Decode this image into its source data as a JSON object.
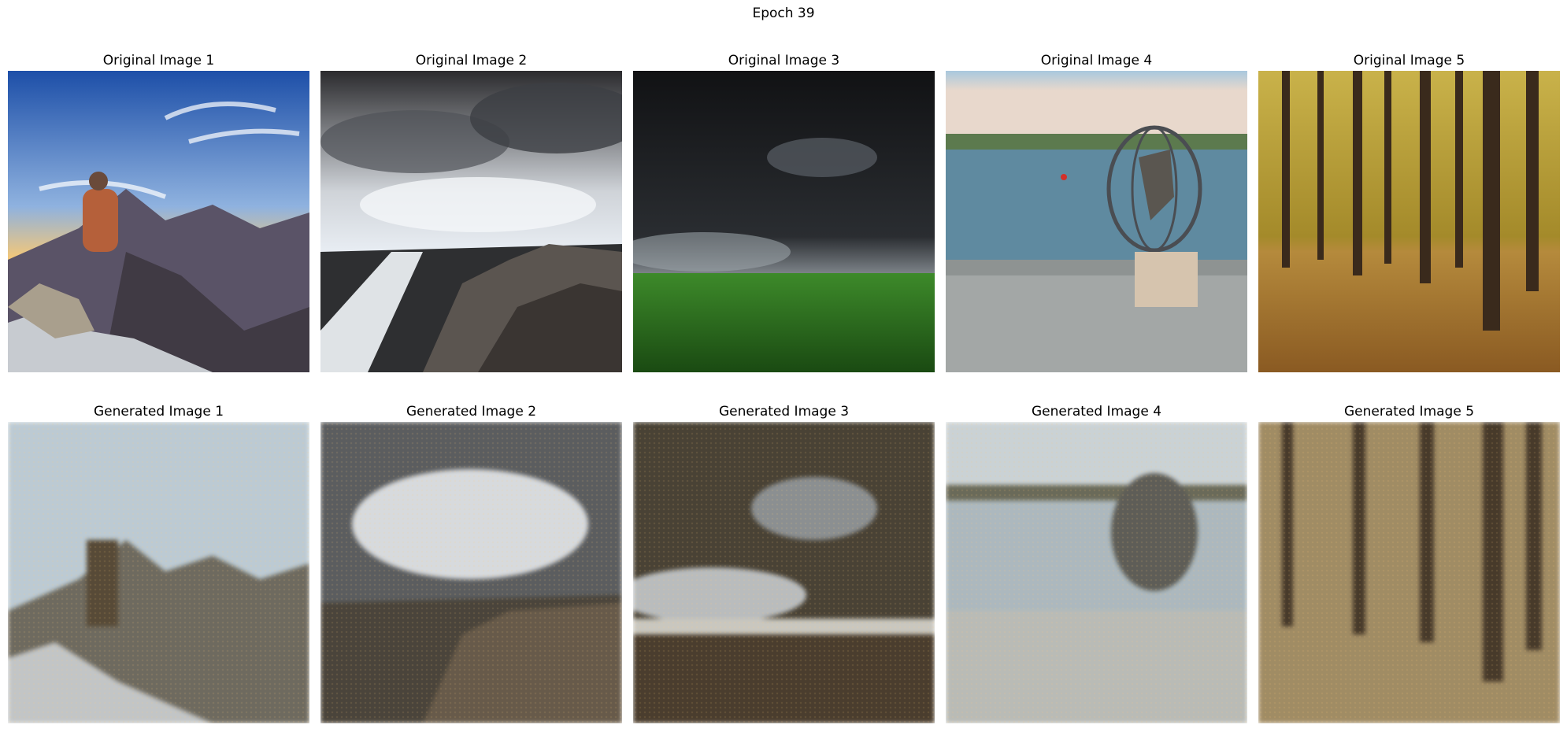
{
  "title": "Epoch 39",
  "originals": [
    {
      "label": "Original Image 1",
      "scene": "hiker-on-mountain"
    },
    {
      "label": "Original Image 2",
      "scene": "stormy-coast"
    },
    {
      "label": "Original Image 3",
      "scene": "storm-over-field"
    },
    {
      "label": "Original Image 4",
      "scene": "globe-sculpture-by-river"
    },
    {
      "label": "Original Image 5",
      "scene": "autumn-forest"
    }
  ],
  "generated": [
    {
      "label": "Generated Image 1",
      "scene": "hiker-on-mountain"
    },
    {
      "label": "Generated Image 2",
      "scene": "stormy-coast"
    },
    {
      "label": "Generated Image 3",
      "scene": "storm-over-field"
    },
    {
      "label": "Generated Image 4",
      "scene": "globe-sculpture-by-river"
    },
    {
      "label": "Generated Image 5",
      "scene": "autumn-forest"
    }
  ]
}
